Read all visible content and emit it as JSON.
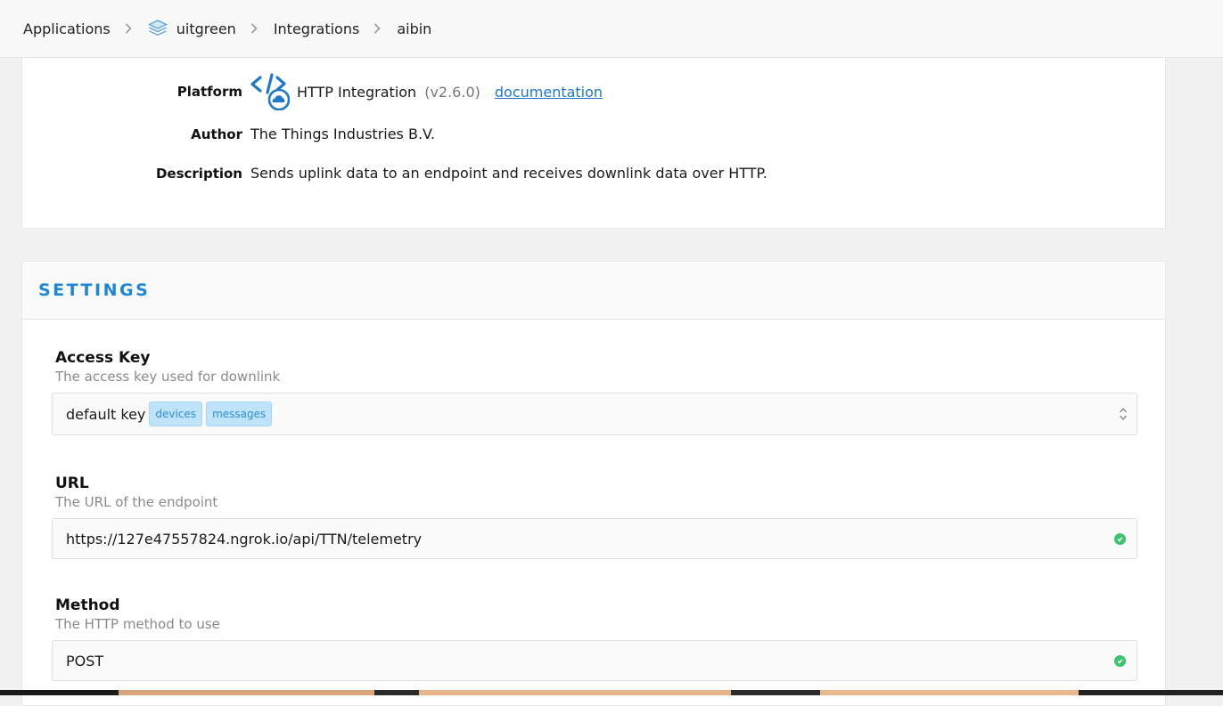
{
  "breadcrumb": {
    "items": [
      "Applications",
      "uitgreen",
      "Integrations",
      "aibin"
    ]
  },
  "info": {
    "platform_label": "Platform",
    "platform_name": "HTTP Integration",
    "platform_version": "(v2.6.0)",
    "documentation_link": "documentation",
    "author_label": "Author",
    "author_value": "The Things Industries B.V.",
    "description_label": "Description",
    "description_value": "Sends uplink data to an endpoint and receives downlink data over HTTP."
  },
  "settings": {
    "title": "SETTINGS",
    "access_key": {
      "label": "Access Key",
      "description": "The access key used for downlink",
      "value": "default key",
      "tags": [
        "devices",
        "messages"
      ]
    },
    "url": {
      "label": "URL",
      "description": "The URL of the endpoint",
      "value": "https://127e47557824.ngrok.io/api/TTN/telemetry"
    },
    "method": {
      "label": "Method",
      "description": "The HTTP method to use",
      "value": "POST"
    }
  },
  "colors": {
    "accent": "#1d86d6",
    "link": "#1f78c8",
    "tag_bg": "#bfe3fb",
    "valid": "#3cc36b"
  }
}
